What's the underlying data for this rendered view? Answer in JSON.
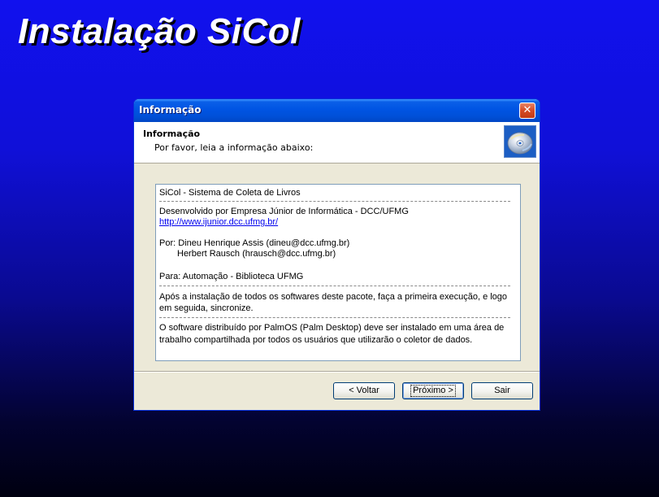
{
  "installer": {
    "title": "Instalação SiCol"
  },
  "dialog": {
    "title": "Informação",
    "close_glyph": "✕",
    "header": {
      "title": "Informação",
      "subtitle": "Por favor, leia a informação abaixo:",
      "icon": "cd-disc-icon"
    },
    "content": {
      "line1": "SiCol - Sistema de Coleta de Livros",
      "line2": "Desenvolvido por Empresa Júnior de Informática - DCC/UFMG",
      "link": "http://www.ijunior.dcc.ufmg.br/",
      "line3": "Por: Dineu Henrique Assis (dineu@dcc.ufmg.br)",
      "line4": "Herbert Rausch (hrausch@dcc.ufmg.br)",
      "line5": "Para: Automação - Biblioteca UFMG",
      "line6a": "Após a instalação de todos os softwares deste pacote, faça a primeira execução, e logo",
      "line6b": "em seguida, sincronize.",
      "line7a": "O software distribuído por PalmOS (Palm Desktop) deve ser instalado em uma área de",
      "line7b": "trabalho compartilhada por todos os usuários que utilizarão o coletor de dados."
    },
    "buttons": {
      "back": "< Voltar",
      "next": "Próximo >",
      "exit": "Sair"
    }
  },
  "colors": {
    "titlebar": "#0054e3",
    "dialog_bg": "#ece9d8",
    "background_top": "#1111ee",
    "link": "#0000ee"
  }
}
